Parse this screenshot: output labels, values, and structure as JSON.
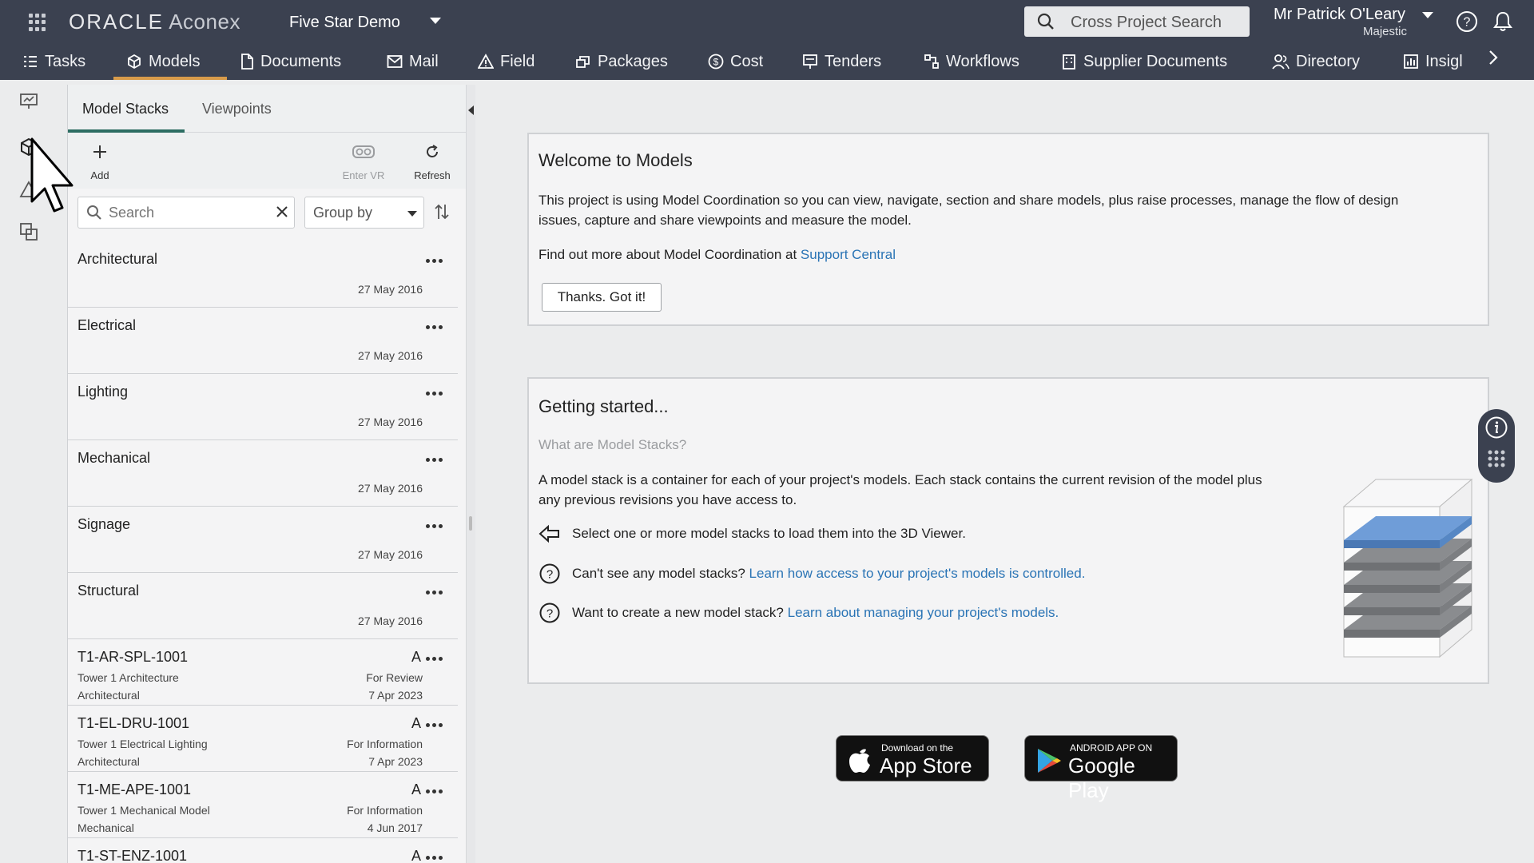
{
  "header": {
    "brand_oracle": "ORACLE",
    "brand_aconex": "Aconex",
    "project": "Five Star Demo",
    "cross_search": "Cross Project Search",
    "user_name": "Mr Patrick O'Leary",
    "company": "Majestic"
  },
  "nav": {
    "items": [
      {
        "label": "Tasks",
        "icon": "tasks-icon"
      },
      {
        "label": "Models",
        "icon": "cube-icon"
      },
      {
        "label": "Documents",
        "icon": "document-icon"
      },
      {
        "label": "Mail",
        "icon": "mail-icon"
      },
      {
        "label": "Field",
        "icon": "warning-triangle-icon"
      },
      {
        "label": "Packages",
        "icon": "packages-icon"
      },
      {
        "label": "Cost",
        "icon": "dollar-icon"
      },
      {
        "label": "Tenders",
        "icon": "tenders-icon"
      },
      {
        "label": "Workflows",
        "icon": "workflow-icon"
      },
      {
        "label": "Supplier Documents",
        "icon": "building-icon"
      },
      {
        "label": "Directory",
        "icon": "people-icon"
      },
      {
        "label": "Insigl",
        "icon": "chart-icon"
      }
    ],
    "active": "Models"
  },
  "panel": {
    "tabs": [
      "Model Stacks",
      "Viewpoints"
    ],
    "toolbar": {
      "add": "Add",
      "enter_vr": "Enter VR",
      "refresh": "Refresh"
    },
    "search_placeholder": "Search",
    "group_by": "Group by",
    "stacks": [
      {
        "name": "Architectural",
        "date": "27 May 2016"
      },
      {
        "name": "Electrical",
        "date": "27 May 2016"
      },
      {
        "name": "Lighting",
        "date": "27 May 2016"
      },
      {
        "name": "Mechanical",
        "date": "27 May 2016"
      },
      {
        "name": "Signage",
        "date": "27 May 2016"
      },
      {
        "name": "Structural",
        "date": "27 May 2016"
      }
    ],
    "documents": [
      {
        "name": "T1-AR-SPL-1001",
        "rev": "A",
        "title": "Tower 1 Architecture",
        "discipline": "Architectural",
        "status": "For Review",
        "date": "7 Apr 2023"
      },
      {
        "name": "T1-EL-DRU-1001",
        "rev": "A",
        "title": "Tower 1 Electrical Lighting",
        "discipline": "Architectural",
        "status": "For Information",
        "date": "7 Apr 2023"
      },
      {
        "name": "T1-ME-APE-1001",
        "rev": "A",
        "title": "Tower 1 Mechanical Model",
        "discipline": "Mechanical",
        "status": "For Information",
        "date": "4 Jun 2017"
      },
      {
        "name": "T1-ST-ENZ-1001",
        "rev": "A",
        "title": "",
        "discipline": "",
        "status": "",
        "date": ""
      }
    ]
  },
  "welcome": {
    "title": "Welcome to Models",
    "body_line1": "This project is using Model Coordination so you can view, navigate, section and share models, plus raise processes, manage the flow of design",
    "body_line2": "issues, capture and share viewpoints and measure the model.",
    "find_out": "Find out more about Model Coordination at ",
    "support_link": "Support Central",
    "button": "Thanks. Got it!"
  },
  "getting_started": {
    "title": "Getting started...",
    "question": "What are Model Stacks?",
    "desc_line1": "A model stack is a container for each of your project's models. Each stack contains the current revision of the model plus",
    "desc_line2": "any previous revisions you have access to.",
    "tip1": "Select one or more model stacks to load them into the 3D Viewer.",
    "tip2_text": "Can't see any model stacks? ",
    "tip2_link": "Learn how access to your project's models is controlled.",
    "tip3_text": "Want to create a new model stack? ",
    "tip3_link": "Learn about managing your project's models."
  },
  "stores": {
    "apple_small": "Download on the",
    "apple_big": "App Store",
    "google_small": "ANDROID APP ON",
    "google_big": "Google Play"
  },
  "colors": {
    "header_bg": "#3b4150",
    "active_tab": "#d89b4a",
    "link": "#2a74b5",
    "panel_tab_accent": "#2c6d62"
  }
}
